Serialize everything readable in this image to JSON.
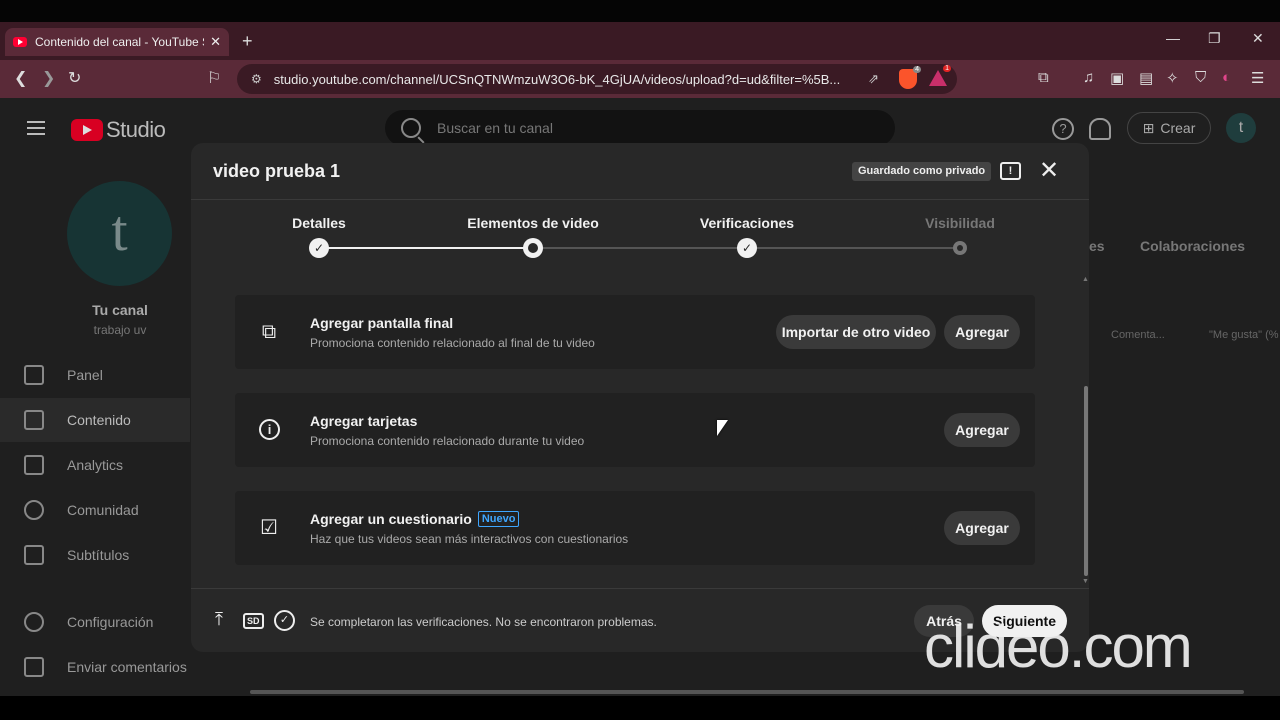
{
  "browser": {
    "tab_title": "Contenido del canal - YouTube S",
    "tab_close": "✕",
    "new_tab": "+",
    "url": "studio.youtube.com/channel/UCSnQTNWmzuW3O6-bK_4GjUA/videos/upload?d=ud&filter=%5B...",
    "brave_badge": "4",
    "rewards_badge": "1",
    "window_controls": [
      "—",
      "❐",
      "✕"
    ]
  },
  "studio": {
    "logo_text": "Studio",
    "search_placeholder": "Buscar en tu canal",
    "create_label": "Crear",
    "avatar_letter": "t",
    "channel_avatar_letter": "t",
    "channel_name": "Tu canal",
    "channel_handle": "trabajo uv",
    "sidebar": [
      {
        "label": "Panel"
      },
      {
        "label": "Contenido"
      },
      {
        "label": "Analytics"
      },
      {
        "label": "Comunidad"
      },
      {
        "label": "Subtítulos"
      },
      {
        "label": "Configuración"
      },
      {
        "label": "Enviar comentarios"
      }
    ],
    "right_tabs": [
      "es",
      "Colaboraciones"
    ],
    "right_columns": [
      "Comenta...",
      "\"Me gusta\" (%"
    ]
  },
  "dialog": {
    "title": "video prueba 1",
    "saved_badge": "Guardado como privado",
    "steps": [
      {
        "label": "Detalles",
        "state": "done"
      },
      {
        "label": "Elementos de video",
        "state": "current"
      },
      {
        "label": "Verificaciones",
        "state": "done"
      },
      {
        "label": "Visibilidad",
        "state": "pending"
      }
    ],
    "cards": [
      {
        "title": "Agregar pantalla final",
        "desc": "Promociona contenido relacionado al final de tu video",
        "secondary_button": "Importar de otro video",
        "button": "Agregar"
      },
      {
        "title": "Agregar tarjetas",
        "desc": "Promociona contenido relacionado durante tu video",
        "button": "Agregar"
      },
      {
        "title": "Agregar un cuestionario",
        "badge": "Nuevo",
        "desc": "Haz que tus videos sean más interactivos con cuestionarios",
        "button": "Agregar"
      }
    ],
    "footer": {
      "sd_label": "SD",
      "message": "Se completaron las verificaciones. No se encontraron problemas.",
      "back_label": "Atrás",
      "next_label": "Siguiente"
    }
  },
  "watermark": "clideo.com",
  "colors": {
    "tab_bar": "#3a1a24",
    "nav_bar": "#5a2a38",
    "dialog_bg": "#282828",
    "accent_blue": "#3ea6ff",
    "brand_red": "#ff0033"
  }
}
